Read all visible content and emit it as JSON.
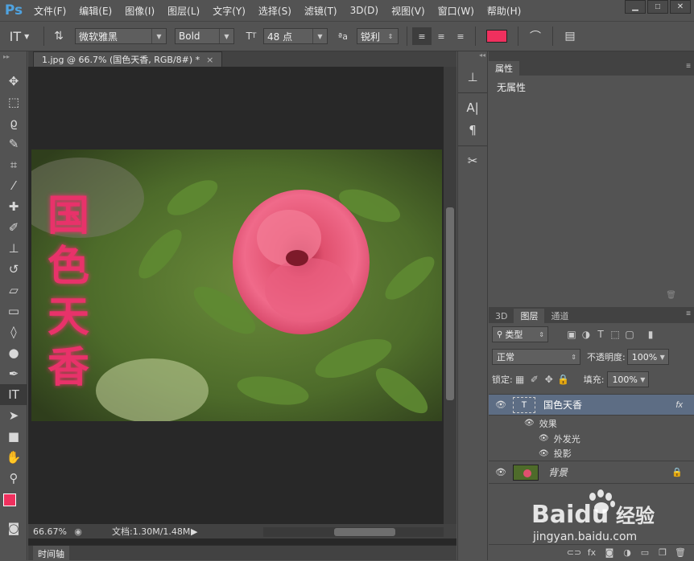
{
  "app": {
    "logo": "Ps"
  },
  "menu": [
    "文件(F)",
    "编辑(E)",
    "图像(I)",
    "图层(L)",
    "文字(Y)",
    "选择(S)",
    "滤镜(T)",
    "3D(D)",
    "视图(V)",
    "窗口(W)",
    "帮助(H)"
  ],
  "options": {
    "font_family": "微软雅黑",
    "font_style": "Bold",
    "font_size": "48 点",
    "aa_label": "ªa",
    "aa_mode": "锐利",
    "text_color": "#f0305e"
  },
  "document": {
    "tab_title": "1.jpg @ 66.7% (国色天香, RGB/8#) *",
    "canvas_text": [
      "国",
      "色",
      "天",
      "香"
    ],
    "canvas_text_color": "#e8306a",
    "zoom": "66.67%",
    "doc_info": "文档:1.30M/1.48M"
  },
  "timeline": {
    "label": "时间轴"
  },
  "properties": {
    "tab": "属性",
    "content": "无属性"
  },
  "layers_panel": {
    "tabs": [
      "3D",
      "图层",
      "通道"
    ],
    "filter_kind": "类型",
    "blend_mode": "正常",
    "opacity_label": "不透明度:",
    "opacity": "100%",
    "lock_label": "锁定:",
    "fill_label": "填充:",
    "fill": "100%",
    "layers": [
      {
        "name": "国色天香",
        "type": "text",
        "fx": "fx",
        "selected": true
      },
      {
        "name": "效果",
        "type": "effect-group"
      },
      {
        "name": "外发光",
        "type": "effect"
      },
      {
        "name": "投影",
        "type": "effect"
      },
      {
        "name": "背景",
        "type": "background",
        "locked": true
      }
    ]
  },
  "watermark": {
    "brand": "Baidu",
    "suffix": "经验",
    "url": "jingyan.baidu.com"
  }
}
